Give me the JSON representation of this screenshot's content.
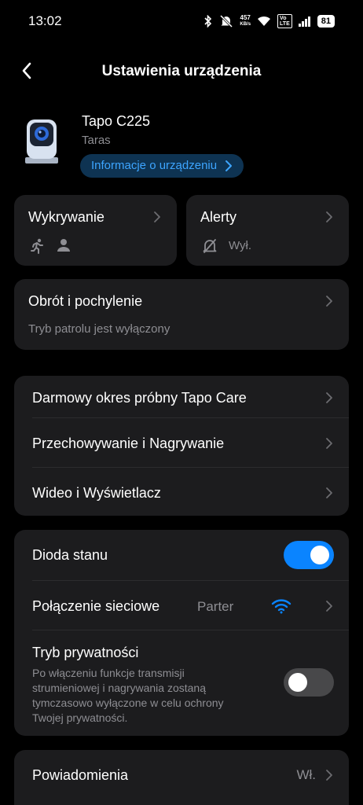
{
  "status_bar": {
    "time": "13:02",
    "net_speed_value": "457",
    "net_speed_unit": "KB/s",
    "volte_top": "Vo",
    "volte_bottom": "LTE",
    "battery": "81",
    "icons": [
      "bluetooth-icon",
      "mute-icon",
      "wifi-icon",
      "signal-icon",
      "battery-icon"
    ]
  },
  "header": {
    "title": "Ustawienia urządzenia",
    "back_icon": "chevron-left-icon"
  },
  "device": {
    "name": "Tapo C225",
    "location": "Taras",
    "info_button": "Informacje o urządzeniu"
  },
  "detection_card": {
    "title": "Wykrywanie",
    "icons": [
      "person-running-icon",
      "person-icon"
    ]
  },
  "alerts_card": {
    "title": "Alerty",
    "status": "Wył.",
    "icon": "bell-off-icon"
  },
  "pan_tilt_card": {
    "title": "Obrót i pochylenie",
    "subtitle": "Tryb patrolu jest wyłączony"
  },
  "services_group": {
    "items": [
      {
        "label": "Darmowy okres próbny Tapo Care"
      },
      {
        "label": "Przechowywanie i Nagrywanie"
      },
      {
        "label": "Wideo i Wyświetlacz"
      }
    ]
  },
  "settings_group": {
    "status_led": {
      "label": "Dioda stanu",
      "on": true
    },
    "network": {
      "label": "Połączenie sieciowe",
      "value": "Parter"
    },
    "privacy": {
      "label": "Tryb prywatności",
      "description_lines": [
        "Po włączeniu funkcje transmisji",
        "strumieniowej i nagrywania zostaną",
        "tymczasowo wyłączone w celu ochrony",
        "Twojej prywatności."
      ],
      "on": false
    }
  },
  "notifications": {
    "label": "Powiadomienia",
    "value": "Wł."
  },
  "colors": {
    "background": "#000000",
    "card": "#1c1c1e",
    "accent": "#0a84ff",
    "link": "#3da5ff",
    "secondary_text": "#8e8e93"
  }
}
